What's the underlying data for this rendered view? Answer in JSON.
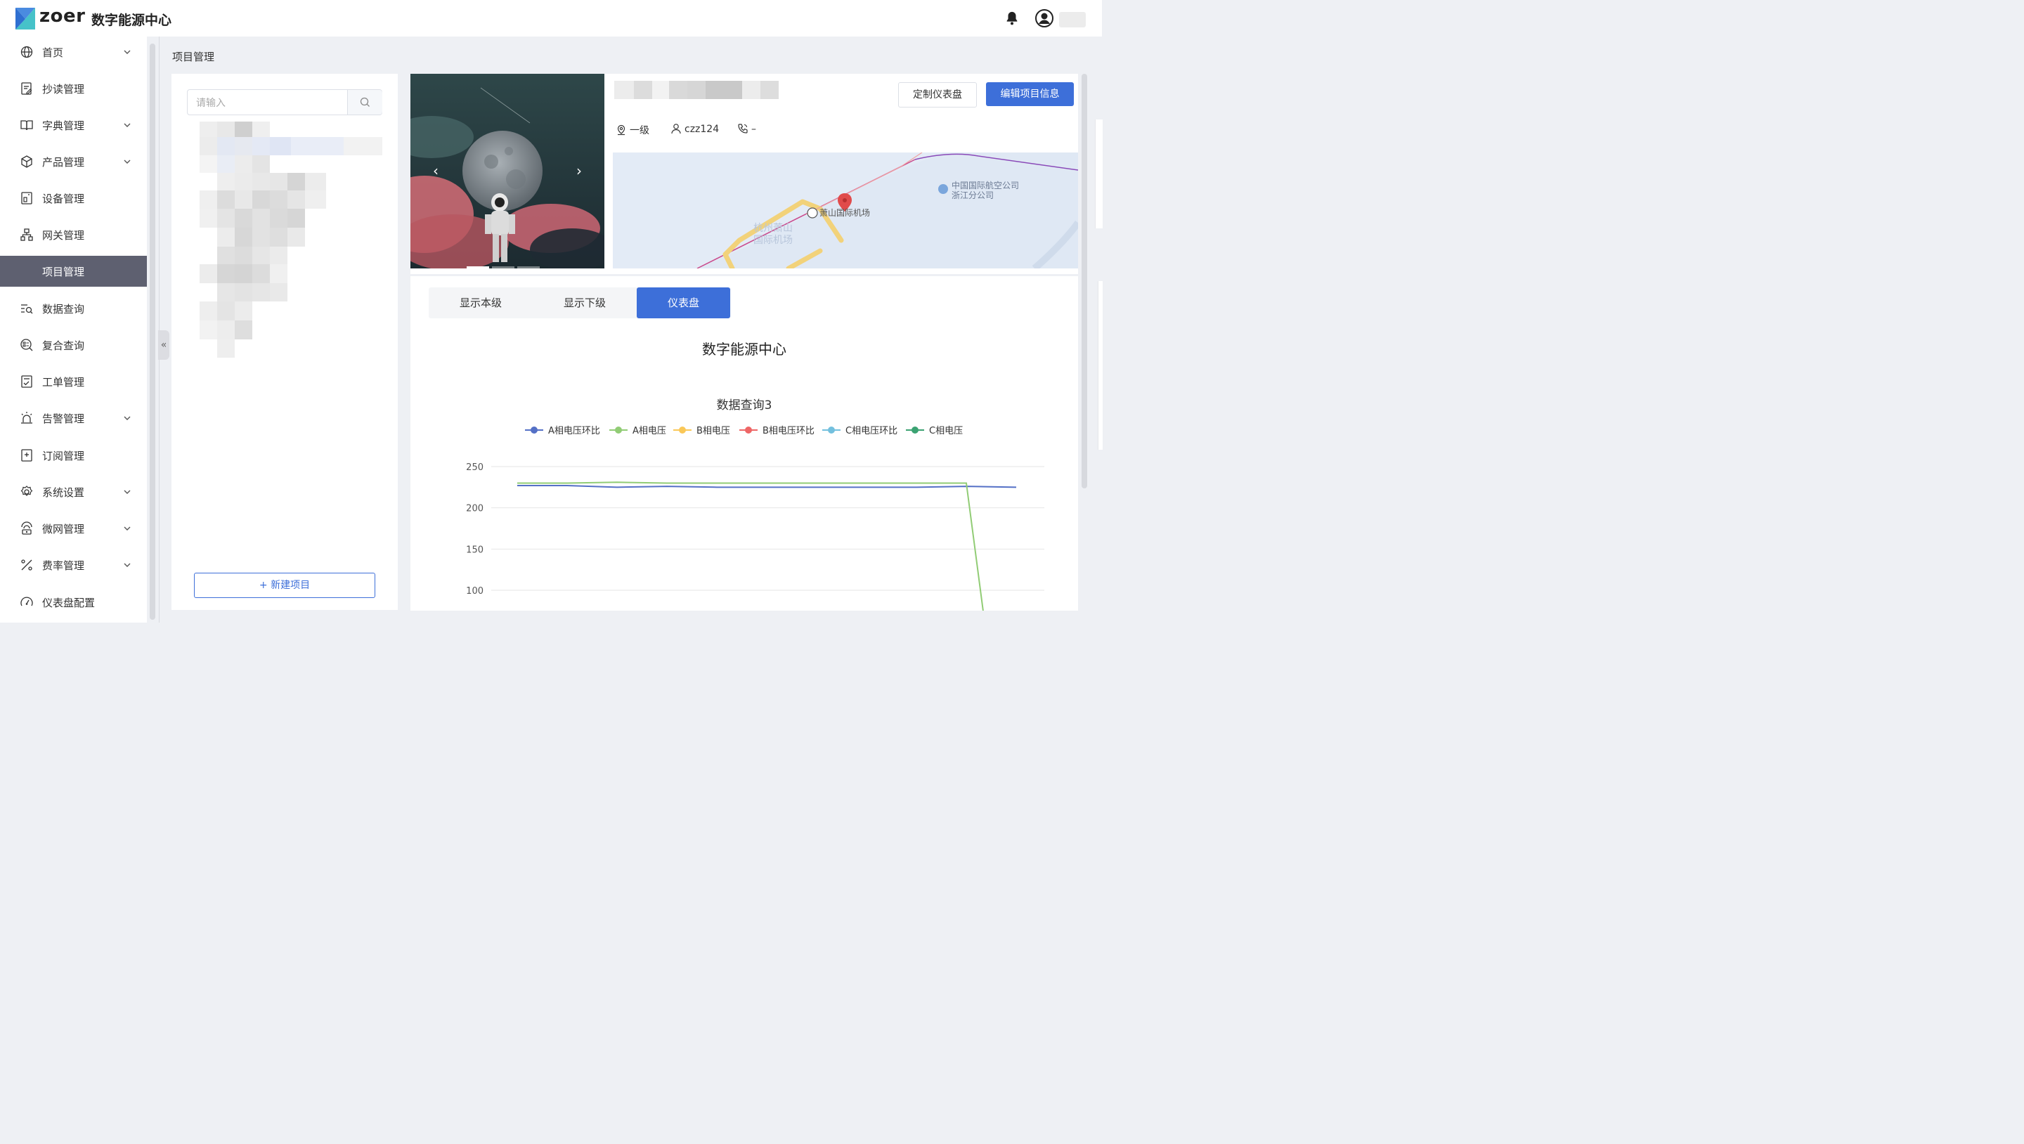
{
  "header": {
    "brand": "zoer",
    "app_title": "数字能源中心"
  },
  "sidebar": {
    "items": [
      {
        "label": "首页",
        "icon": "globe-icon",
        "has_children": true
      },
      {
        "label": "抄读管理",
        "icon": "edit-document-icon",
        "has_children": false
      },
      {
        "label": "字典管理",
        "icon": "book-icon",
        "has_children": true
      },
      {
        "label": "产品管理",
        "icon": "box-icon",
        "has_children": true
      },
      {
        "label": "设备管理",
        "icon": "device-icon",
        "has_children": false
      },
      {
        "label": "网关管理",
        "icon": "network-icon",
        "has_children": false
      },
      {
        "label": "项目管理",
        "icon": "",
        "has_children": false,
        "active": true
      },
      {
        "label": "数据查询",
        "icon": "data-search-icon",
        "has_children": false
      },
      {
        "label": "复合查询",
        "icon": "compound-search-icon",
        "has_children": false
      },
      {
        "label": "工单管理",
        "icon": "checklist-icon",
        "has_children": false
      },
      {
        "label": "告警管理",
        "icon": "alarm-icon",
        "has_children": true
      },
      {
        "label": "订阅管理",
        "icon": "subscribe-icon",
        "has_children": false
      },
      {
        "label": "系统设置",
        "icon": "gear-icon",
        "has_children": true
      },
      {
        "label": "微网管理",
        "icon": "microgrid-icon",
        "has_children": true
      },
      {
        "label": "费率管理",
        "icon": "rate-icon",
        "has_children": true
      },
      {
        "label": "仪表盘配置",
        "icon": "gauge-icon",
        "has_children": false
      }
    ]
  },
  "page": {
    "title": "项目管理"
  },
  "project_list": {
    "search_placeholder": "请输入",
    "new_project_label": "+ 新建项目"
  },
  "project_info": {
    "buttons": {
      "customize_dashboard": "定制仪表盘",
      "edit_project": "编辑项目信息"
    },
    "level": "一级",
    "owner": "czz124",
    "phone": "–",
    "map_labels": {
      "airport": "萧山国际机场",
      "airport_area_line1": "杭州萧山",
      "airport_area_line2": "国际机场",
      "poi_line1": "中国国际航空公司",
      "poi_line2": "浙江分公司"
    }
  },
  "dashboard": {
    "tabs": [
      {
        "label": "显示本级",
        "active": false
      },
      {
        "label": "显示下级",
        "active": false
      },
      {
        "label": "仪表盘",
        "active": true
      }
    ],
    "title": "数字能源中心"
  },
  "chart_data": {
    "type": "line",
    "title": "数据查询3",
    "xlabel": "",
    "ylabel": "",
    "ylim": [
      100,
      250
    ],
    "yticks": [
      100,
      150,
      200,
      250
    ],
    "grid": true,
    "legend_position": "top-center",
    "series": [
      {
        "name": "A相电压环比",
        "color": "#5470c6",
        "values": [
          227,
          227,
          225,
          226,
          225,
          225,
          225,
          225,
          225,
          226,
          225
        ]
      },
      {
        "name": "A相电压",
        "color": "#91cc75",
        "values": [
          230,
          230,
          231,
          230,
          230,
          230,
          230,
          230,
          230,
          230,
          0
        ]
      },
      {
        "name": "B相电压",
        "color": "#fac858",
        "values": []
      },
      {
        "name": "B相电压环比",
        "color": "#ee6666",
        "values": []
      },
      {
        "name": "C相电压环比",
        "color": "#73c0de",
        "values": []
      },
      {
        "name": "C相电压",
        "color": "#3ba272",
        "values": []
      }
    ]
  }
}
